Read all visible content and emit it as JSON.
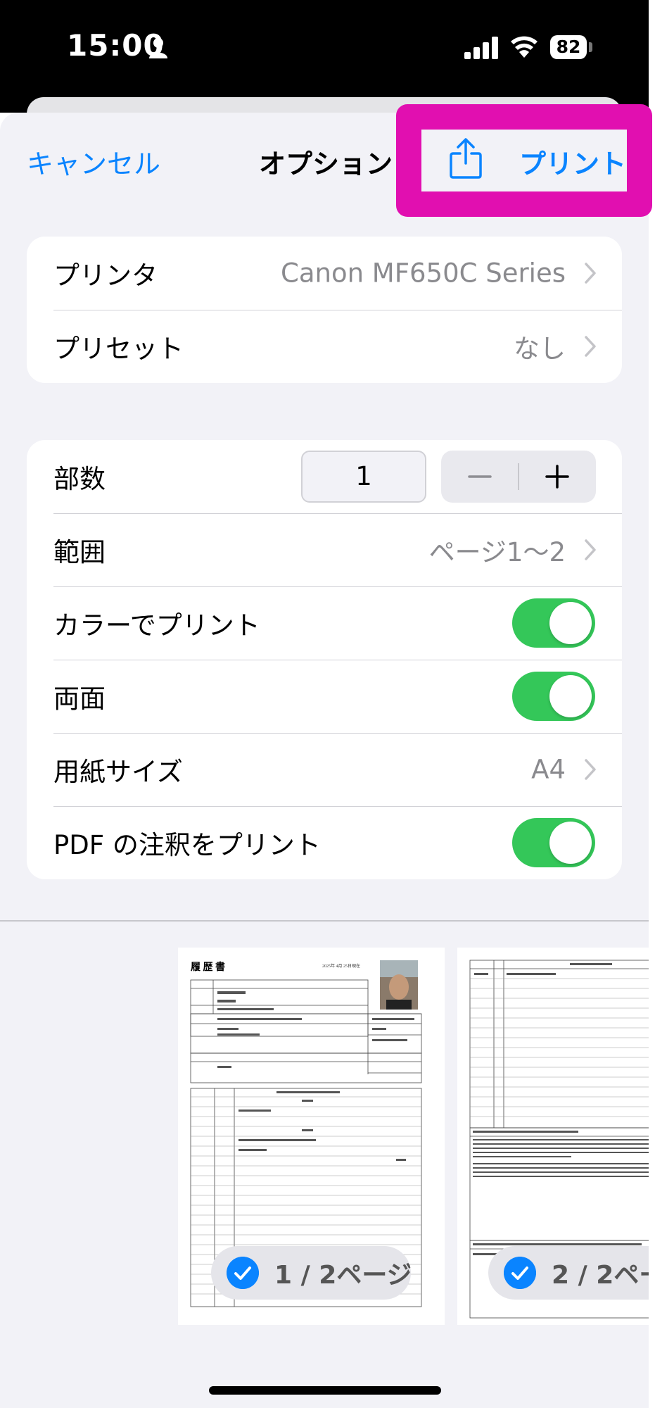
{
  "status_bar": {
    "time": "15:00",
    "battery": "82"
  },
  "nav": {
    "cancel": "キャンセル",
    "title": "オプション",
    "print": "プリント",
    "share_icon": "share-icon",
    "highlight_color": "#e10fb0"
  },
  "printer_group": {
    "printer_label": "プリンタ",
    "printer_value": "Canon MF650C Series",
    "preset_label": "プリセット",
    "preset_value": "なし"
  },
  "options_group": {
    "copies_label": "部数",
    "copies_value": "1",
    "range_label": "範囲",
    "range_value": "ページ1〜2",
    "color_label": "カラーでプリント",
    "color_on": true,
    "duplex_label": "両面",
    "duplex_on": true,
    "paper_label": "用紙サイズ",
    "paper_value": "A4",
    "annotations_label": "PDF の注釈をプリント",
    "annotations_on": true
  },
  "previews": {
    "page1_label": "1 / 2ページ",
    "page2_label": "2 / 2ペー",
    "doc_title": "履 歴 書",
    "doc_date": "2025年 4月 25日現在"
  },
  "colors": {
    "accent": "#0a84ff",
    "toggle_on": "#34c759",
    "background": "#f2f2f7"
  }
}
